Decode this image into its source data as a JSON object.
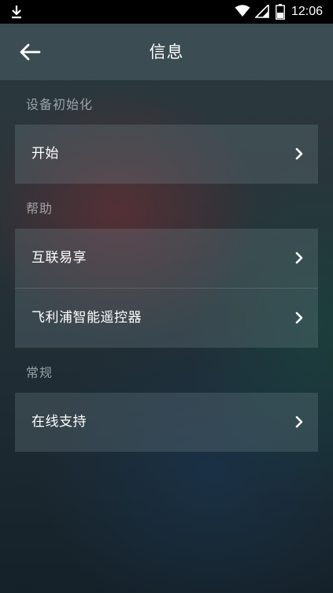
{
  "status_bar": {
    "time": "12:06",
    "icons": [
      "download-icon",
      "wifi-icon",
      "signal-icon",
      "battery-icon"
    ]
  },
  "header": {
    "title": "信息",
    "back_icon": "back-arrow-icon"
  },
  "sections": [
    {
      "label": "设备初始化",
      "items": [
        {
          "label": "开始"
        }
      ]
    },
    {
      "label": "帮助",
      "items": [
        {
          "label": "互联易享"
        },
        {
          "label": "飞利浦智能遥控器"
        }
      ]
    },
    {
      "label": "常规",
      "items": [
        {
          "label": "在线支持"
        }
      ]
    }
  ],
  "colors": {
    "status_bar": "#000000",
    "text": "#ffffff",
    "section_label": "#a9b3b6"
  }
}
